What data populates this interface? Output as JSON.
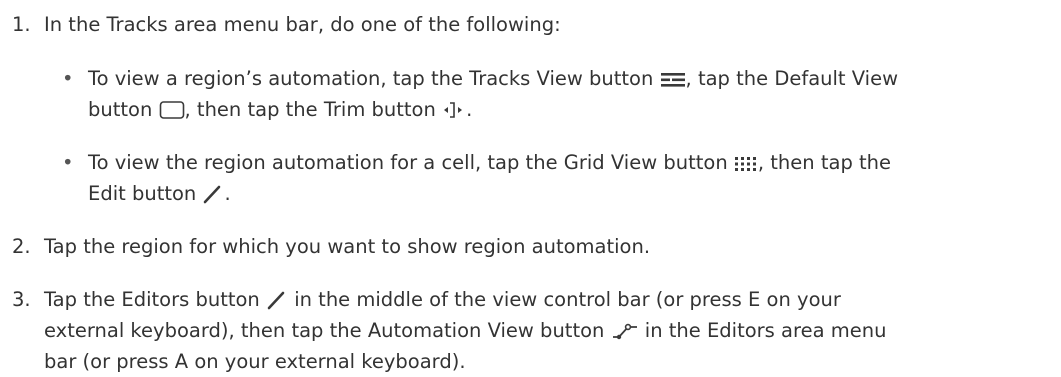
{
  "steps": [
    {
      "num": "1.",
      "text": "In the Tracks area menu bar, do one of the following:",
      "bullets": [
        {
          "dot": "•",
          "a": "To view a region’s automation, tap the Tracks View button",
          "b": ", tap the Default View",
          "c": "button",
          "d": ", then tap the Trim button",
          "e": "."
        },
        {
          "dot": "•",
          "a": "To view the region automation for a cell, tap the Grid View button",
          "b": ", then tap the",
          "c": "Edit button",
          "d": "."
        }
      ]
    },
    {
      "num": "2.",
      "text": "Tap the region for which you want to show region automation."
    },
    {
      "num": "3.",
      "a": "Tap the Editors button",
      "b": "in the middle of the view control bar (or press E on your",
      "c": "external keyboard), then tap the Automation View button",
      "d": "in the Editors area menu",
      "e": "bar (or press A on your external keyboard)."
    }
  ],
  "icons": {
    "tracks_view": "tracks-view-icon",
    "default_view": "default-view-icon",
    "trim": "trim-icon",
    "grid_view": "grid-view-icon",
    "edit": "edit-pencil-icon",
    "editors": "editors-pencil-icon",
    "automation_view": "automation-view-icon"
  },
  "colors": {
    "text": "#333333"
  }
}
